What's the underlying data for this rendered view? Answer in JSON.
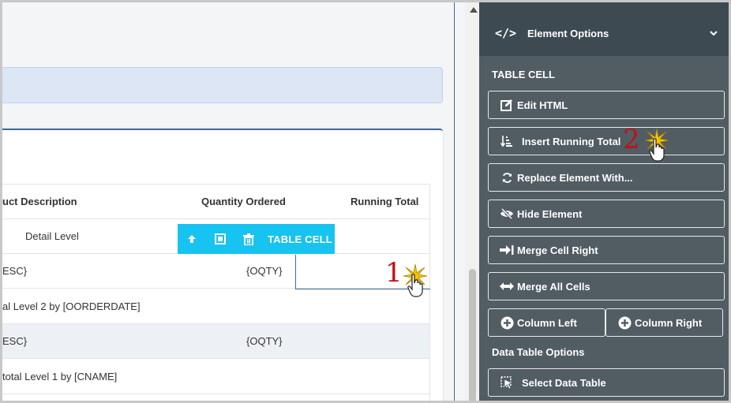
{
  "table": {
    "headers": [
      "uct Description",
      "Quantity Ordered",
      "Running Total"
    ],
    "rows": [
      {
        "desc": "Detail Level",
        "qty": "",
        "total": ""
      },
      {
        "desc": "ESC}",
        "qty": "{OQTY}",
        "total": ""
      },
      {
        "desc": "al Level 2 by [OORDERDATE]",
        "qty": "",
        "total": ""
      },
      {
        "desc": "ESC}",
        "qty": "{OQTY}",
        "total": ""
      },
      {
        "desc": "total Level 1 by [CNAME]",
        "qty": "",
        "total": ""
      }
    ]
  },
  "cell_toolbar": {
    "label": "TABLE CELL",
    "icons": [
      "arrow-up-icon",
      "select-square-icon",
      "trash-icon"
    ]
  },
  "callouts": {
    "one": "1",
    "two": "2"
  },
  "panel": {
    "header_code": "</>",
    "header_title": "Element Options",
    "section_table_cell": "TABLE CELL",
    "buttons": {
      "edit_html": "Edit HTML",
      "insert_running_total": "Insert Running Total",
      "replace_element": "Replace Element With...",
      "hide_element": "Hide Element",
      "merge_cell_right": "Merge Cell Right",
      "merge_all_cells": "Merge All Cells",
      "column_left": "Column Left",
      "column_right": "Column Right",
      "select_data_table": "Select Data Table"
    },
    "section_data_table": "Data Table Options"
  },
  "colors": {
    "panel_bg": "#525c63",
    "panel_header_bg": "#3e4a52",
    "toolbar_bg": "#17c3f0",
    "callout_red": "#c0101b"
  }
}
